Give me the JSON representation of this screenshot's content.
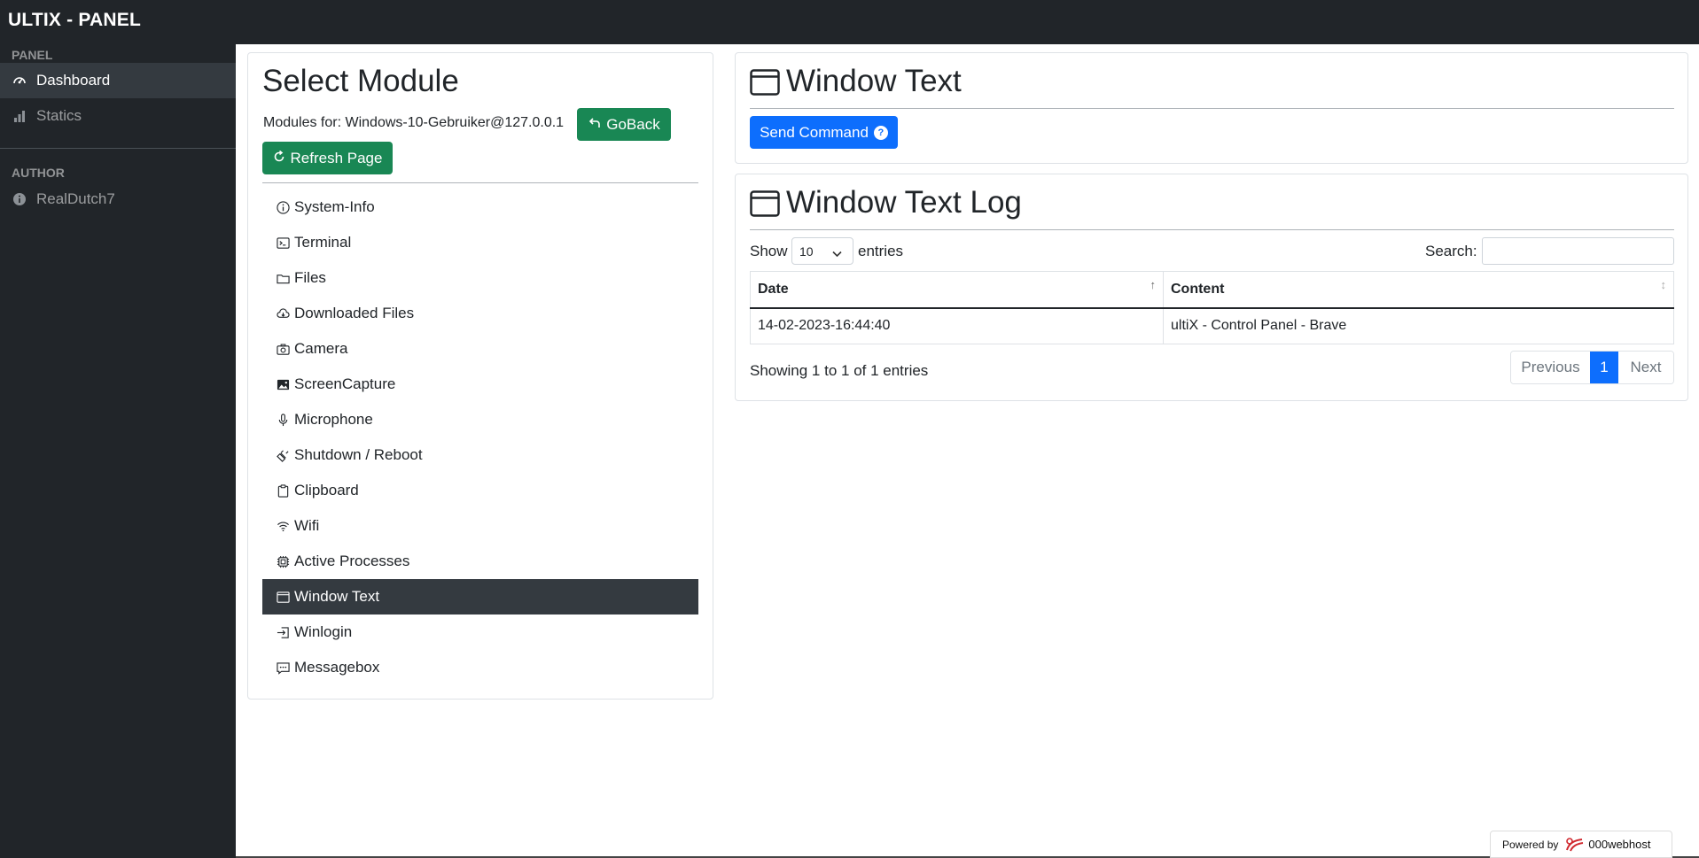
{
  "app": {
    "title": "ULTIX - PANEL"
  },
  "sidebar": {
    "panel_heading": "PANEL",
    "author_heading": "AUTHOR",
    "items": [
      {
        "label": "Dashboard",
        "icon": "speedometer-icon",
        "active": true
      },
      {
        "label": "Statics",
        "icon": "bar-chart-icon",
        "active": false
      }
    ],
    "author": {
      "label": "RealDutch7",
      "icon": "info-circle-icon"
    }
  },
  "select_module": {
    "title": "Select Module",
    "modules_for_label": "Modules for: Windows-10-Gebruiker@127.0.0.1",
    "goback_label": "GoBack",
    "refresh_label": "Refresh Page",
    "modules": [
      {
        "label": "System-Info",
        "icon": "info-icon",
        "active": false
      },
      {
        "label": "Terminal",
        "icon": "terminal-icon",
        "active": false
      },
      {
        "label": "Files",
        "icon": "folder-icon",
        "active": false
      },
      {
        "label": "Downloaded Files",
        "icon": "cloud-download-icon",
        "active": false
      },
      {
        "label": "Camera",
        "icon": "camera-icon",
        "active": false
      },
      {
        "label": "ScreenCapture",
        "icon": "image-icon",
        "active": false
      },
      {
        "label": "Microphone",
        "icon": "mic-icon",
        "active": false
      },
      {
        "label": "Shutdown / Reboot",
        "icon": "plug-icon",
        "active": false
      },
      {
        "label": "Clipboard",
        "icon": "clipboard-icon",
        "active": false
      },
      {
        "label": "Wifi",
        "icon": "wifi-icon",
        "active": false
      },
      {
        "label": "Active Processes",
        "icon": "cpu-icon",
        "active": false
      },
      {
        "label": "Window Text",
        "icon": "window-icon",
        "active": true
      },
      {
        "label": "Winlogin",
        "icon": "login-icon",
        "active": false
      },
      {
        "label": "Messagebox",
        "icon": "chat-icon",
        "active": false
      }
    ]
  },
  "window_text": {
    "title": "Window Text",
    "send_command_label": "Send Command",
    "help_glyph": "?"
  },
  "window_text_log": {
    "title": "Window Text Log",
    "show_label": "Show",
    "entries_label": "entries",
    "page_size": "10",
    "search_label": "Search:",
    "search_value": "",
    "columns": [
      "Date",
      "Content"
    ],
    "rows": [
      {
        "date": "14-02-2023-16:44:40",
        "content": "ultiX - Control Panel - Brave"
      }
    ],
    "info": "Showing 1 to 1 of 1 entries",
    "pagination": {
      "previous": "Previous",
      "current": "1",
      "next": "Next"
    }
  },
  "footer": {
    "powered_by": "Powered by",
    "host": "000webhost"
  },
  "colors": {
    "dark": "#212529",
    "active_dark": "#343a40",
    "green": "#198754",
    "blue": "#0d6efd"
  }
}
